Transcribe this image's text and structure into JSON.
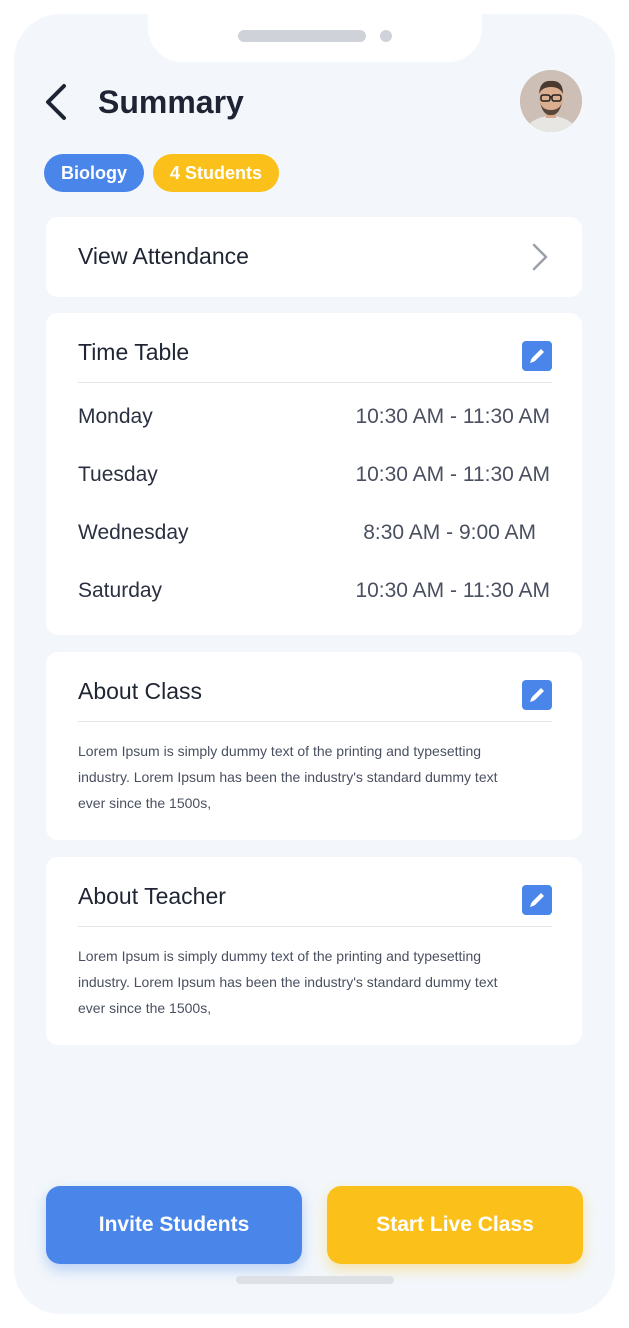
{
  "header": {
    "title": "Summary"
  },
  "tags": [
    {
      "label": "Biology",
      "color": "#4a86ea"
    },
    {
      "label": "4 Students",
      "color": "#fbc11a"
    }
  ],
  "attendance": {
    "label": "View Attendance"
  },
  "timetable": {
    "title": "Time Table",
    "rows": [
      {
        "day": "Monday",
        "time": "10:30 AM - 11:30 AM"
      },
      {
        "day": "Tuesday",
        "time": "10:30 AM - 11:30 AM"
      },
      {
        "day": "Wednesday",
        "time": "8:30 AM - 9:00 AM"
      },
      {
        "day": "Saturday",
        "time": "10:30 AM - 11:30 AM"
      }
    ]
  },
  "about_class": {
    "title": "About Class",
    "text": "Lorem Ipsum is simply dummy text of the printing and typesetting industry. Lorem Ipsum has been the industry's standard dummy text ever since the 1500s,"
  },
  "about_teacher": {
    "title": "About Teacher",
    "text": "Lorem Ipsum is simply dummy text of the printing and typesetting industry. Lorem Ipsum has been the industry's standard dummy text ever since the 1500s,"
  },
  "actions": {
    "invite": "Invite Students",
    "start": "Start Live Class"
  },
  "colors": {
    "primary": "#4a86ea",
    "accent": "#fbc11a",
    "background": "#f3f7fb"
  },
  "icons": {
    "back": "chevron-left-icon",
    "attendance": "chevron-right-icon",
    "edit": "pencil-edit-icon"
  }
}
